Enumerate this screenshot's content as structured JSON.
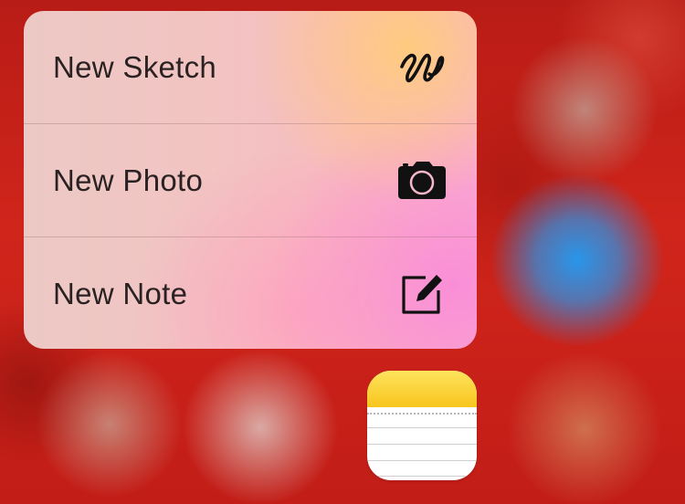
{
  "quick_actions": {
    "items": [
      {
        "label": "New Sketch",
        "icon": "scribble-icon"
      },
      {
        "label": "New Photo",
        "icon": "camera-icon"
      },
      {
        "label": "New Note",
        "icon": "compose-icon"
      }
    ]
  },
  "home_screen": {
    "app_icon": "notes-app-icon"
  },
  "colors": {
    "label_text": "#2a2222",
    "icon_stroke": "#111111",
    "notes_yellow": "#f8c51c"
  }
}
